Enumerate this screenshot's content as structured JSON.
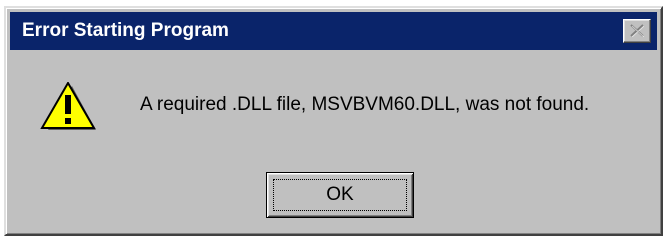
{
  "dialog": {
    "title": "Error Starting Program",
    "message": "A required .DLL file, MSVBVM60.DLL, was not found.",
    "ok_label": "OK",
    "icon": "warning-icon",
    "close_icon": "close-icon"
  },
  "colors": {
    "titlebar": "#0a246a",
    "face": "#c0c0c0",
    "warning_yellow": "#ffff00"
  }
}
